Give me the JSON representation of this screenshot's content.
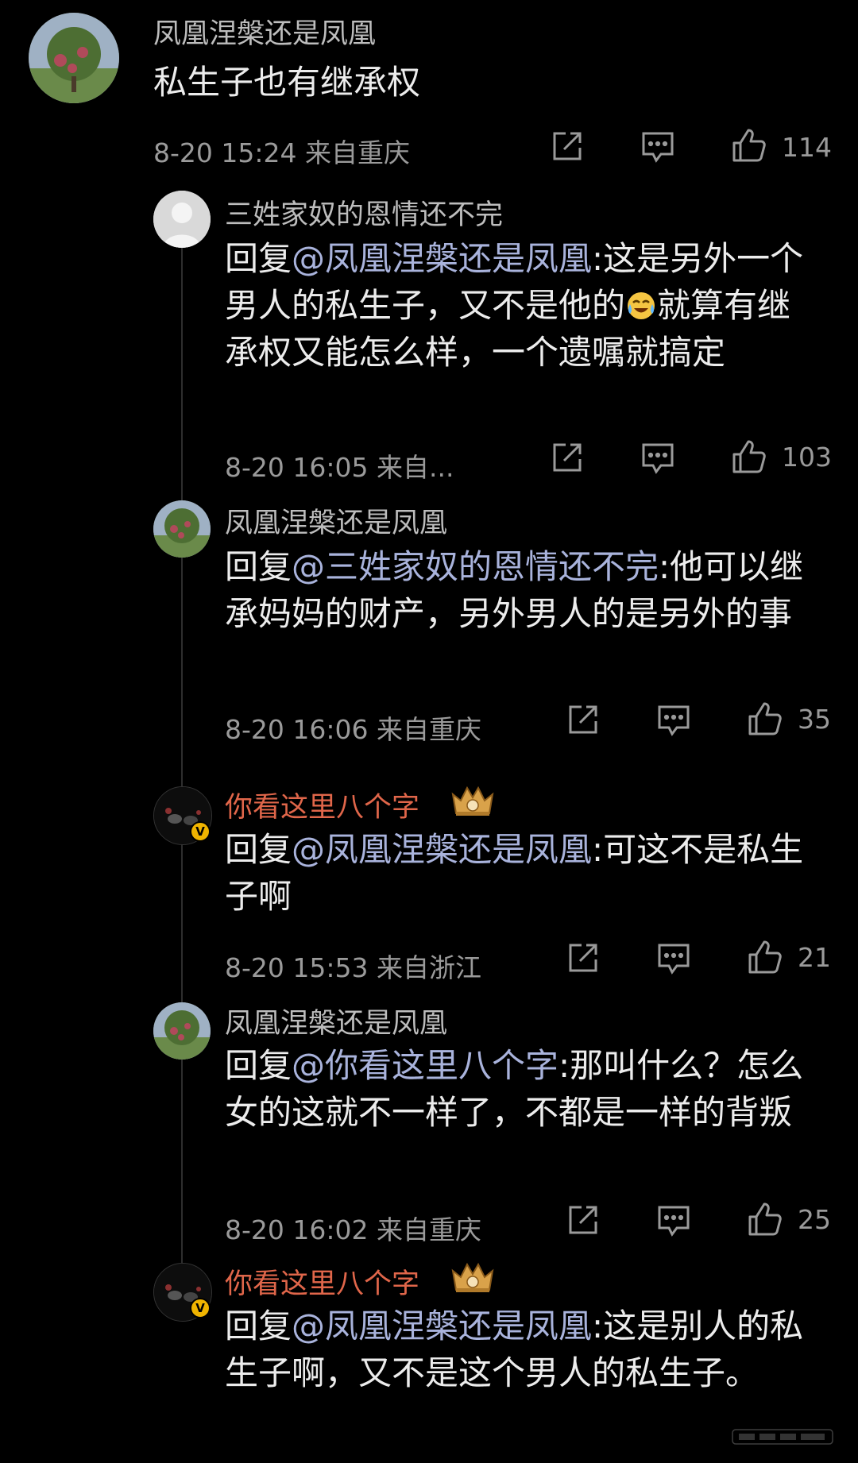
{
  "colors": {
    "background": "#000000",
    "username": "#bdbdbd",
    "vip_username": "#e0664a",
    "mention": "#a9b3dc",
    "meta": "#9a9a9a"
  },
  "icons": {
    "share": "share-icon",
    "reply": "reply-icon",
    "like": "thumbs-up-icon",
    "crown": "crown-badge-icon",
    "verified": "verified-badge-icon"
  },
  "main_comment": {
    "username": "凤凰涅槃还是凤凰",
    "text": "私生子也有继承权",
    "meta": "8-20 15:24 来自重庆",
    "likes": "114"
  },
  "replies": [
    {
      "username": "三姓家奴的恩情还不完",
      "reply_prefix": "回复",
      "mention": "@凤凰涅槃还是凤凰",
      "text_part1": ":这是另外一个男人的私生子，又不是他的",
      "emoji": "laughing-crying-emoji",
      "text_part2": "就算有继承权又能怎么样，一个遗嘱就搞定",
      "meta": "8-20 16:05 来自...",
      "likes": "103"
    },
    {
      "username": "凤凰涅槃还是凤凰",
      "reply_prefix": "回复",
      "mention": "@三姓家奴的恩情还不完",
      "text": ":他可以继承妈妈的财产，另外男人的是另外的事",
      "meta": "8-20 16:06 来自重庆",
      "likes": "35"
    },
    {
      "username": "你看这里八个字",
      "reply_prefix": "回复",
      "mention": "@凤凰涅槃还是凤凰",
      "text": ":可这不是私生子啊",
      "meta": "8-20 15:53 来自浙江",
      "likes": "21"
    },
    {
      "username": "凤凰涅槃还是凤凰",
      "reply_prefix": "回复",
      "mention": "@你看这里八个字",
      "text": ":那叫什么？怎么女的这就不一样了，不都是一样的背叛",
      "meta": "8-20 16:02 来自重庆",
      "likes": "25"
    },
    {
      "username": "你看这里八个字",
      "reply_prefix": "回复",
      "mention": "@凤凰涅槃还是凤凰",
      "text": ":这是别人的私生子啊，又不是这个男人的私生子。"
    }
  ],
  "badge": {
    "verified_letter": "V"
  }
}
